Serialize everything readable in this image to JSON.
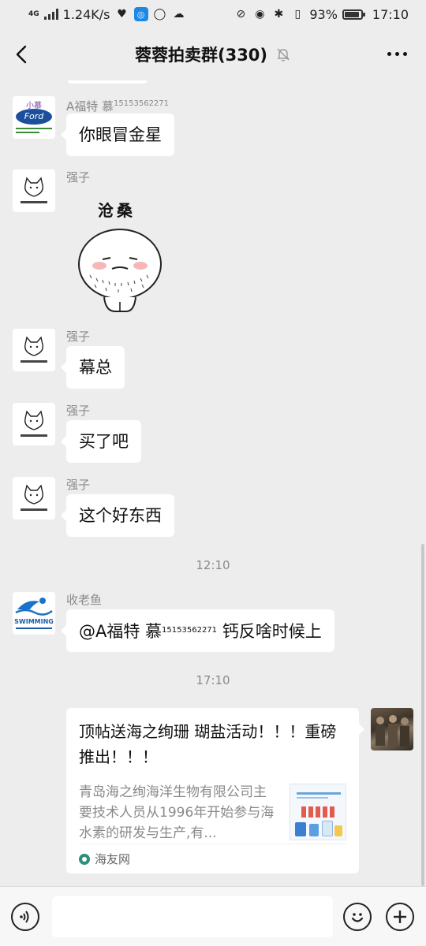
{
  "status_bar": {
    "network_type": "4G",
    "speed": "1.24K/s",
    "battery": "93%",
    "battery_level": 0.93,
    "time": "17:10"
  },
  "header": {
    "title": "蓉蓉拍卖群(330)",
    "back_icon": "chevron-left-icon",
    "mute_icon": "bell-off-icon",
    "more_icon": "more-dots-icon"
  },
  "messages": [
    {
      "sender_name": "A福特 慕",
      "sender_phone": "15153562271",
      "text": "你眼冒金星",
      "avatar_text_top": "小慕",
      "avatar_logo": "Ford"
    },
    {
      "sender_name": "强子",
      "sticker_caption": "沧桑",
      "sticker": "hairy-face-sticker"
    },
    {
      "sender_name": "强子",
      "text": "幕总"
    },
    {
      "sender_name": "强子",
      "text": "买了吧"
    },
    {
      "sender_name": "强子",
      "text": "这个好东西"
    },
    {
      "sender_name": "收老鱼",
      "mention_name": "@A福特 慕",
      "mention_phone": "15153562271",
      "text_after": " 钙反啥时候上",
      "avatar_text": "SWIMMING"
    }
  ],
  "timestamps": [
    "12:10",
    "17:10"
  ],
  "link_card": {
    "title": "顶帖送海之绚珊 瑚盐活动！！！重磅推出！！！",
    "description": "青岛海之绚海洋生物有限公司主要技术人员从1996年开始参与海水素的研发与生产,有...",
    "source": "海友网"
  },
  "input_bar": {
    "voice_icon": "voice-icon",
    "emoji_icon": "emoji-icon",
    "plus_icon": "plus-icon",
    "placeholder": ""
  },
  "colors": {
    "background": "#ededed",
    "bubble": "#ffffff",
    "meta_text": "#8a8a8a"
  }
}
